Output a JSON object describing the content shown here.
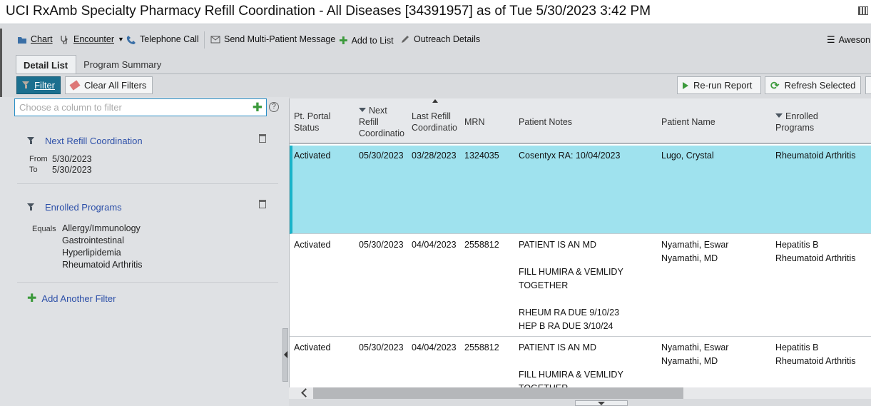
{
  "window": {
    "title": "UCI RxAmb Specialty Pharmacy Refill Coordination - All Diseases [34391957] as of Tue 5/30/2023  3:42 PM"
  },
  "toolbar": {
    "chart": "Chart",
    "encounter": "Encounter",
    "telephone": "Telephone Call",
    "send_message": "Send Multi-Patient Message",
    "add_to_list": "Add to List",
    "outreach": "Outreach Details",
    "awesome": "Aweson"
  },
  "tabs": {
    "detail": "Detail List",
    "summary": "Program Summary"
  },
  "actions": {
    "filter": "Filter",
    "clear_filters": "Clear All Filters",
    "rerun": "Re-run Report",
    "refresh": "Refresh Selected"
  },
  "filter_panel": {
    "placeholder": "Choose a column to filter",
    "help": "?",
    "next_refill": {
      "title": "Next Refill Coordination",
      "from_label": "From",
      "from_value": "5/30/2023",
      "to_label": "To",
      "to_value": "5/30/2023"
    },
    "enrolled": {
      "title": "Enrolled Programs",
      "equals_label": "Equals",
      "values": [
        "Allergy/Immunology",
        "Gastrointestinal",
        "Hyperlipidemia",
        "Rheumatoid Arthritis"
      ]
    },
    "add_another": "Add Another Filter"
  },
  "grid": {
    "columns": {
      "portal_1": "Pt. Portal",
      "portal_2": "Status",
      "next_1": "Next",
      "next_2": "Refill",
      "next_3": "Coordinatio",
      "last_1": "Last Refill",
      "last_2": "Coordinatio",
      "mrn": "MRN",
      "notes": "Patient Notes",
      "name": "Patient Name",
      "enrolled_1": "Enrolled",
      "enrolled_2": "Programs"
    },
    "rows": [
      {
        "status": "Activated",
        "next": "05/30/2023",
        "last": "03/28/2023",
        "mrn": "1324035",
        "notes": [
          "Cosentyx RA: 10/04/2023"
        ],
        "name": [
          "Lugo, Crystal"
        ],
        "programs": [
          "Rheumatoid Arthritis"
        ]
      },
      {
        "status": "Activated",
        "next": "05/30/2023",
        "last": "04/04/2023",
        "mrn": "2558812",
        "notes": [
          "PATIENT IS AN MD",
          "",
          "FILL HUMIRA & VEMLIDY",
          "TOGETHER",
          "",
          "RHEUM RA DUE 9/10/23",
          "HEP B RA DUE 3/10/24"
        ],
        "name": [
          "Nyamathi, Eswar",
          "Nyamathi, MD"
        ],
        "programs": [
          "Hepatitis B",
          "Rheumatoid Arthritis"
        ]
      },
      {
        "status": "Activated",
        "next": "05/30/2023",
        "last": "04/04/2023",
        "mrn": "2558812",
        "notes": [
          "PATIENT IS AN MD",
          "",
          "FILL HUMIRA & VEMLIDY",
          "TOGETHER"
        ],
        "name": [
          "Nyamathi, Eswar",
          "Nyamathi, MD"
        ],
        "programs": [
          "Hepatitis B",
          "Rheumatoid Arthritis"
        ]
      }
    ]
  }
}
